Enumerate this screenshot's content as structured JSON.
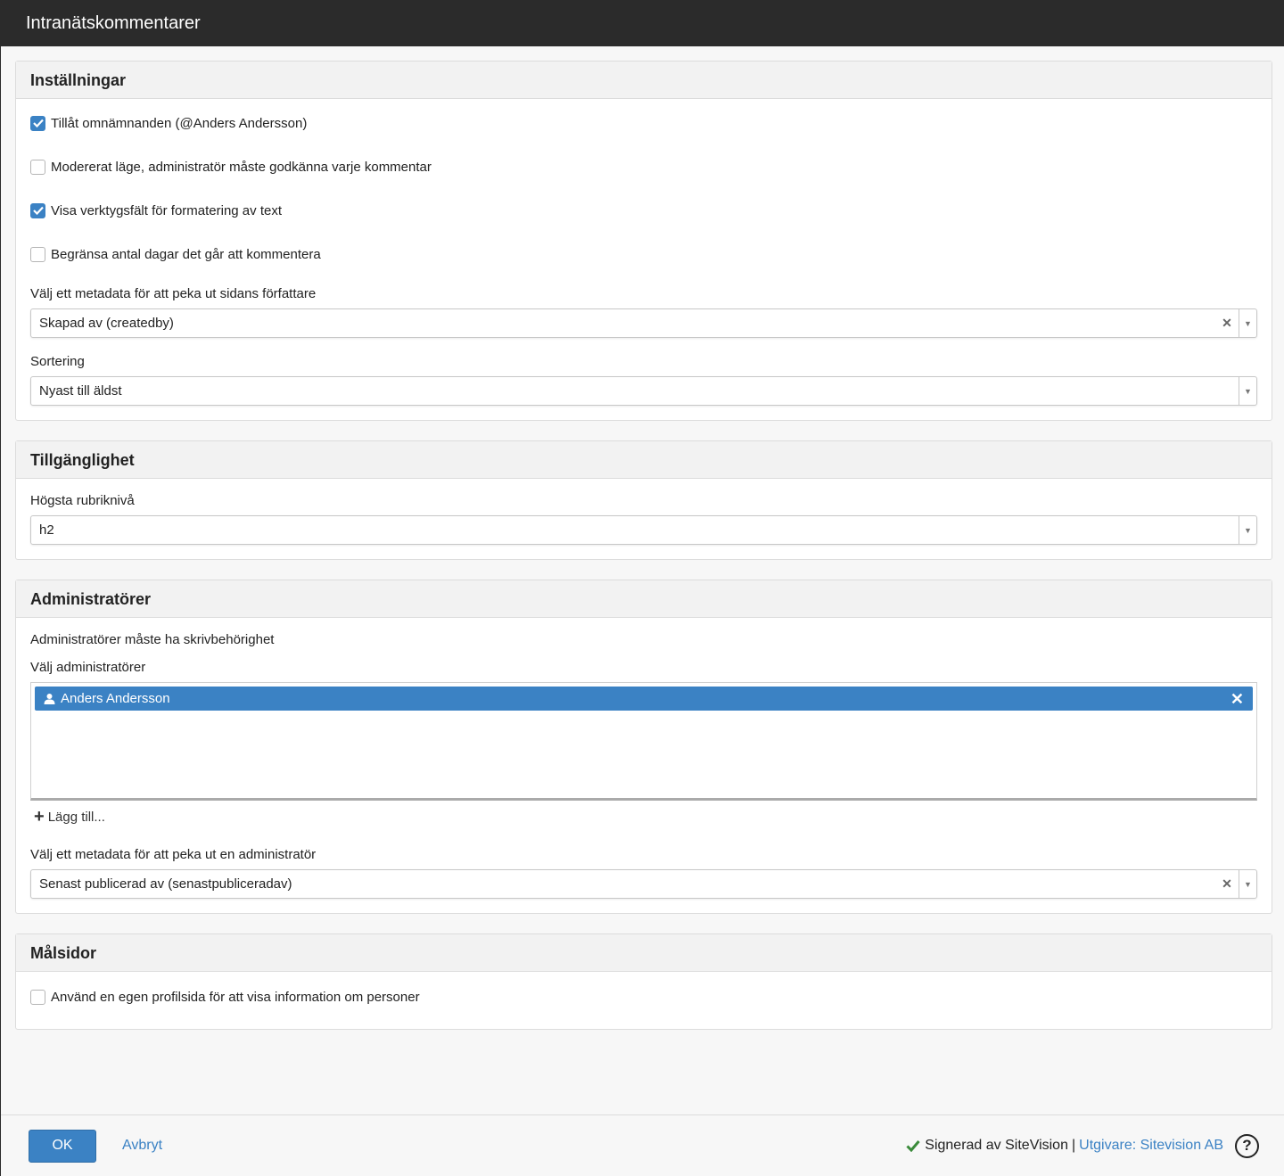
{
  "window": {
    "title": "Intranätskommentarer"
  },
  "settings": {
    "heading": "Inställningar",
    "options": [
      {
        "label": "Tillåt omnämnanden (@Anders Andersson)",
        "checked": true
      },
      {
        "label": "Modererat läge, administratör måste godkänna varje kommentar",
        "checked": false
      },
      {
        "label": "Visa verktygsfält för formatering av text",
        "checked": true
      },
      {
        "label": "Begränsa antal dagar det går att kommentera",
        "checked": false
      }
    ],
    "author_metadata": {
      "label": "Välj ett metadata för att peka ut sidans författare",
      "value": "Skapad av (createdby)"
    },
    "sorting": {
      "label": "Sortering",
      "value": "Nyast till äldst"
    }
  },
  "accessibility": {
    "heading": "Tillgänglighet",
    "heading_level": {
      "label": "Högsta rubriknivå",
      "value": "h2"
    }
  },
  "admins": {
    "heading": "Administratörer",
    "note": "Administratörer måste ha skrivbehörighet",
    "select_label": "Välj administratörer",
    "selected": [
      "Anders Andersson"
    ],
    "add_label": "Lägg till...",
    "metadata": {
      "label": "Välj ett metadata för att peka ut en administratör",
      "value": "Senast publicerad av (senastpubliceradav)"
    }
  },
  "target_pages": {
    "heading": "Målsidor",
    "option": {
      "label": "Använd en egen profilsida för att visa information om personer",
      "checked": false
    }
  },
  "footer": {
    "ok": "OK",
    "cancel": "Avbryt",
    "signed": "Signerad av SiteVision",
    "separator": "|",
    "publisher": "Utgivare: Sitevision AB",
    "help": "?"
  },
  "colors": {
    "accent": "#3b82c4",
    "titlebar": "#2b2b2b",
    "signed_check": "#3a8a3a"
  }
}
